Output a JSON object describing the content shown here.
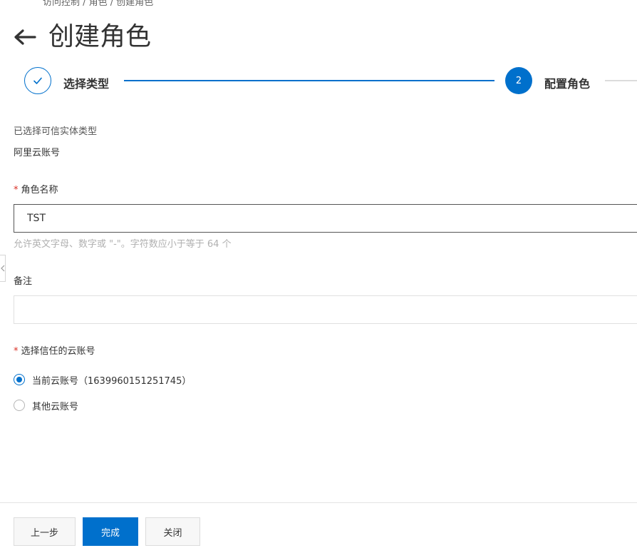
{
  "breadcrumb": {
    "text": "访问控制 / 角色 / 创建角色"
  },
  "header": {
    "title": "创建角色"
  },
  "steps": [
    {
      "label": "选择类型",
      "status": "done"
    },
    {
      "number": "2",
      "label": "配置角色",
      "status": "active"
    }
  ],
  "trusted_entity": {
    "label": "已选择可信实体类型",
    "value": "阿里云账号"
  },
  "role_name": {
    "required_mark": "*",
    "label": "角色名称",
    "value": "TST",
    "help": "允许英文字母、数字或 \"-\"。字符数应小于等于 64 个"
  },
  "remark": {
    "label": "备注",
    "value": ""
  },
  "trusted_account": {
    "required_mark": "*",
    "label": "选择信任的云账号",
    "options": [
      {
        "label": "当前云账号（1639960151251745）",
        "checked": true
      },
      {
        "label": "其他云账号",
        "checked": false
      }
    ]
  },
  "footer": {
    "prev_label": "上一步",
    "done_label": "完成",
    "close_label": "关闭"
  },
  "colors": {
    "primary": "#0070cc",
    "required": "#d93026",
    "help_text": "#b0b0b0"
  },
  "icons": {
    "back": "arrow-left-icon",
    "step_done": "check-icon",
    "side_handle": "chevron-left-icon"
  }
}
